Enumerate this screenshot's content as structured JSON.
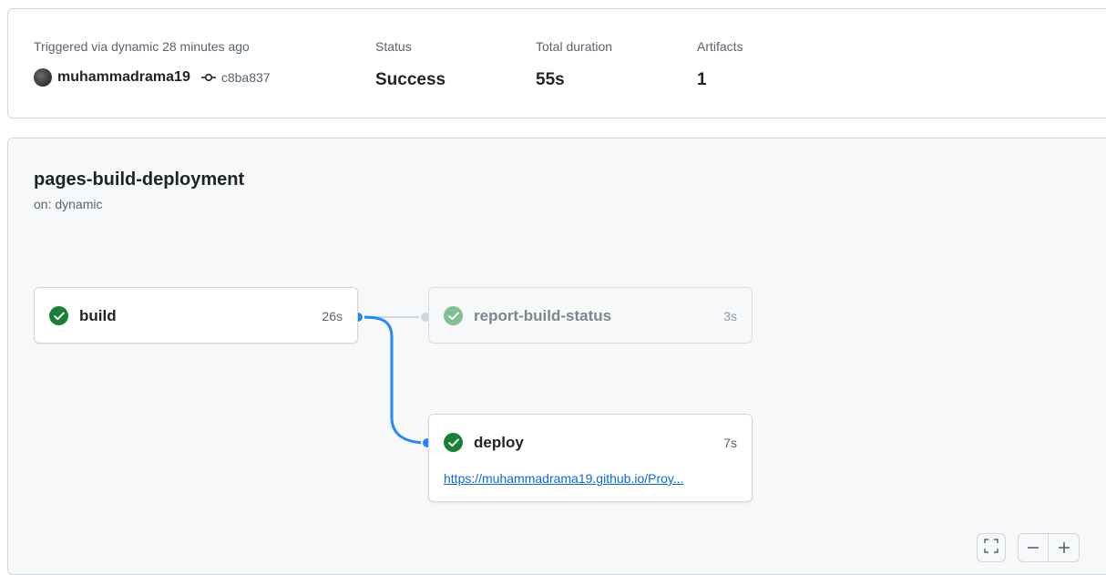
{
  "summary": {
    "trigger_label": "Triggered via dynamic 28 minutes ago",
    "actor": "muhammadrama19",
    "commit_sha": "c8ba837",
    "status_label": "Status",
    "status_value": "Success",
    "duration_label": "Total duration",
    "duration_value": "55s",
    "artifacts_label": "Artifacts",
    "artifacts_value": "1"
  },
  "workflow": {
    "name": "pages-build-deployment",
    "trigger": "on: dynamic",
    "jobs": {
      "build": {
        "name": "build",
        "duration": "26s",
        "status": "success"
      },
      "report": {
        "name": "report-build-status",
        "duration": "3s",
        "status": "success"
      },
      "deploy": {
        "name": "deploy",
        "duration": "7s",
        "status": "success",
        "link": "https://muhammadrama19.github.io/Proy..."
      }
    }
  },
  "colors": {
    "success": "#1a7f37",
    "link": "#0969da",
    "connector_active": "#2188ff",
    "connector_inactive": "#d0d7de"
  },
  "icons": {
    "avatar": "avatar",
    "commit": "git-commit-icon",
    "check": "check-circle-icon",
    "fullscreen": "fullscreen-icon",
    "zoom_out": "zoom-out-icon",
    "zoom_in": "zoom-in-icon"
  }
}
